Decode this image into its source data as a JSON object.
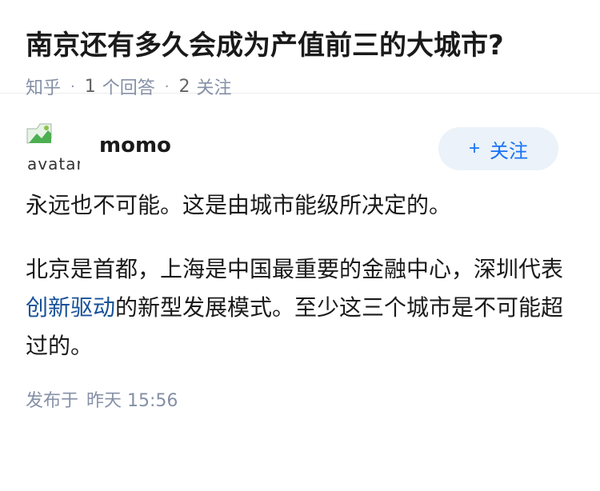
{
  "question": {
    "title": "南京还有多久会成为产值前三的大城市?",
    "source": "知乎",
    "separator": "·",
    "answer_count": "1",
    "answer_label": "个回答",
    "follower_count": "2",
    "follower_label": "关注"
  },
  "answer": {
    "author": {
      "name": "momo",
      "avatar_alt": "avatar"
    },
    "follow_button": {
      "icon": "plus-icon",
      "symbol": "+",
      "label": "关注"
    },
    "paragraph1": "永远也不可能。这是由城市能级所决定的。",
    "paragraph2_before": "北京是首都，上海是中国最重要的金融中心，深圳代表",
    "paragraph2_link": "创新驱动",
    "paragraph2_after": "的新型发展模式。至少这三个城市是不可能超过的。",
    "published_label": "发布于",
    "published_time": "昨天 15:56"
  },
  "colors": {
    "link": "#175199",
    "accent": "#1772f6",
    "follow_bg": "#ebf2f9",
    "meta": "#8590a6"
  }
}
